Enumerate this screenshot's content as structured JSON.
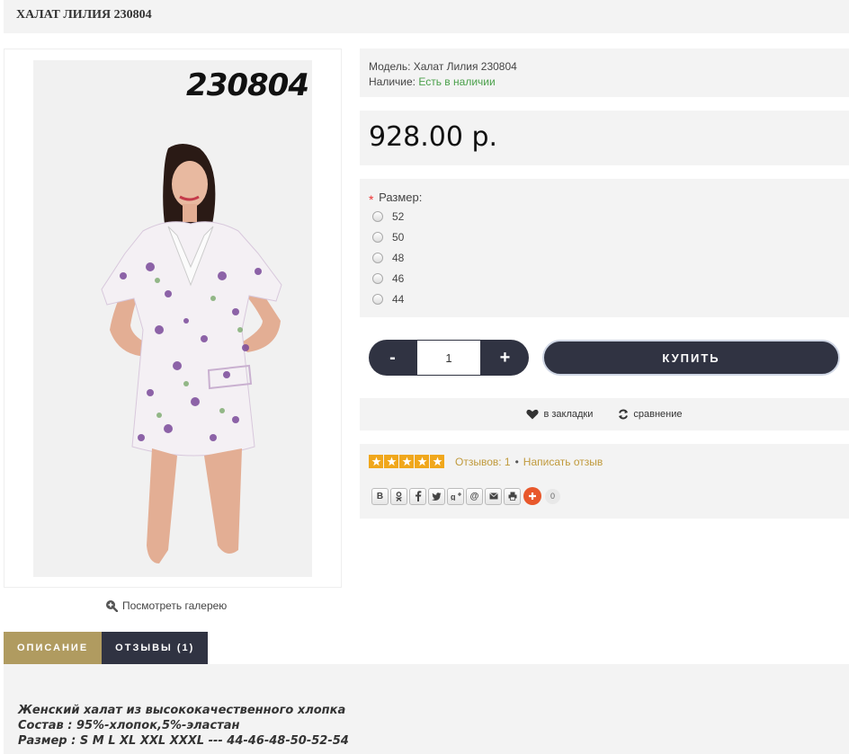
{
  "page": {
    "title": "ХАЛАТ ЛИЛИЯ 230804"
  },
  "product": {
    "image_code": "230804",
    "gallery_link": "Посмотреть галерею",
    "model_label": "Модель:",
    "model_value": "Халат Лилия 230804",
    "stock_label": "Наличие:",
    "stock_value": "Есть в наличии",
    "price": "928.00 р."
  },
  "options": {
    "size_label": "Размер:",
    "required_mark": "*",
    "sizes": [
      "52",
      "50",
      "48",
      "46",
      "44"
    ]
  },
  "purchase": {
    "minus_label": "-",
    "quantity": "1",
    "plus_label": "+",
    "buy_label": "КУПИТЬ"
  },
  "actions": {
    "wishlist_label": "в закладки",
    "compare_label": "сравнение"
  },
  "reviews": {
    "rating": 5,
    "count_text": "Отзывов: 1",
    "separator": "•",
    "write_text": "Написать отзыв"
  },
  "share": {
    "buttons": [
      "В",
      "ok",
      "f",
      "tw",
      "g+",
      "@",
      "mail",
      "print"
    ],
    "count": "0"
  },
  "tabs": [
    {
      "label": "ОПИСАНИЕ",
      "active": true
    },
    {
      "label": "ОТЗЫВЫ (1)",
      "active": false
    }
  ],
  "description": {
    "lines": [
      "Женский халат из высококачественного хлопка",
      "Состав : 95%-хлопок,5%-эластан",
      "Размер : S M L XL XXL XXXL --- 44-46-48-50-52-54"
    ]
  },
  "colors": {
    "accent_gold": "#b09b60",
    "dark": "#303342",
    "stock_green": "#4aa04a",
    "star": "#f0a71c",
    "share_plus": "#e8582c"
  }
}
